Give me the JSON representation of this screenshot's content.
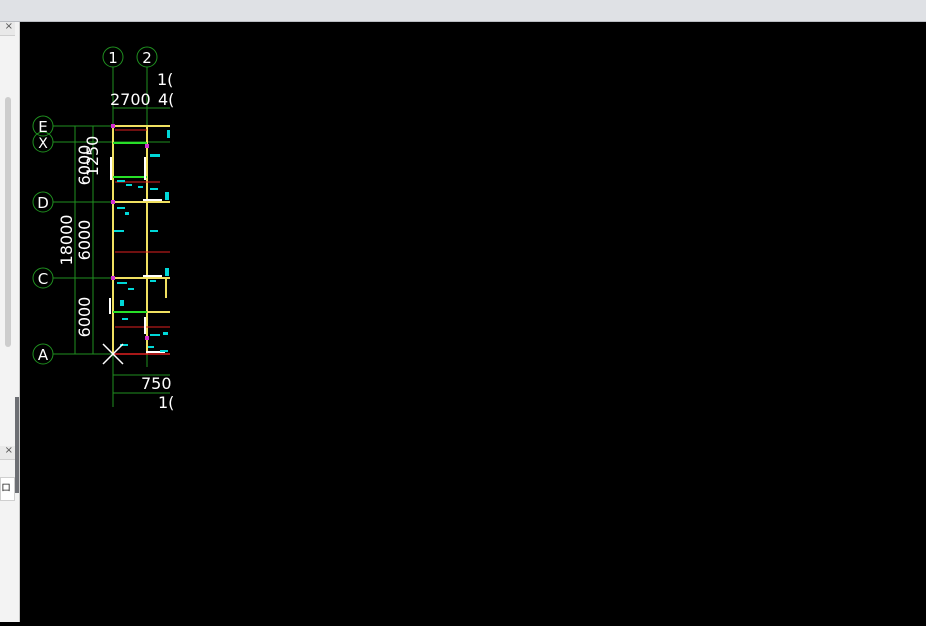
{
  "left_panel": {
    "close_top": "×",
    "close_bottom": "×",
    "field_text": "ロ"
  },
  "drawing": {
    "grid_cols": [
      "1",
      "2"
    ],
    "grid_rows": [
      "E",
      "X",
      "D",
      "C",
      "A"
    ],
    "dim_top": [
      "1(",
      "2700",
      "4("
    ],
    "dim_left": [
      "1250",
      "6000",
      "6000",
      "18000",
      "6000"
    ],
    "dim_bottom": [
      "750",
      "1("
    ]
  },
  "colors": {
    "grid_line": "#1f8f1f",
    "wall": "#f0e060",
    "column": "#00d8d8",
    "accent": "#e02020"
  }
}
